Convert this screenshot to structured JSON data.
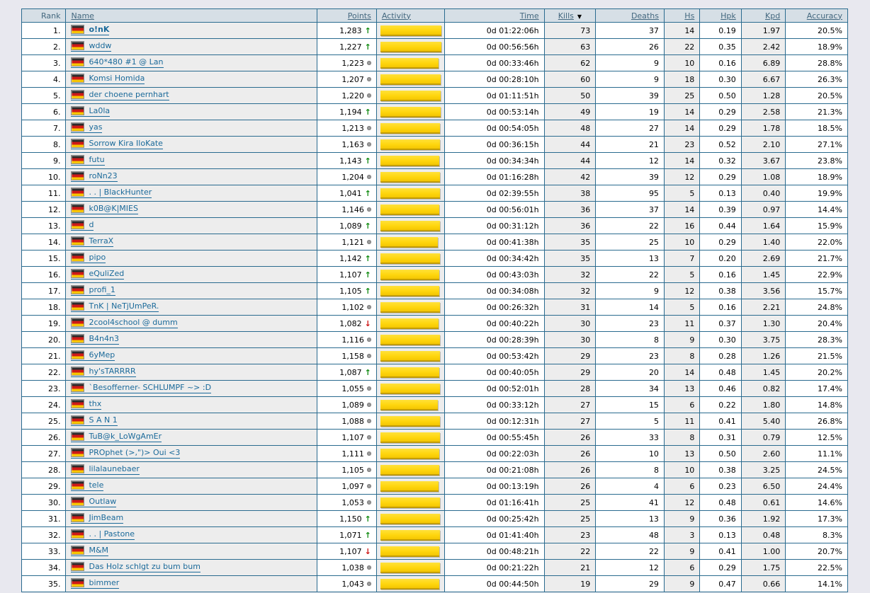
{
  "table": {
    "sorted_by": "Kills",
    "sort_direction": "desc",
    "columns": [
      {
        "label": "Rank"
      },
      {
        "label": "Name"
      },
      {
        "label": "Points"
      },
      {
        "label": "Activity"
      },
      {
        "label": "Time"
      },
      {
        "label": "Kills"
      },
      {
        "label": "Deaths"
      },
      {
        "label": "Hs"
      },
      {
        "label": "Hpk"
      },
      {
        "label": "Kpd"
      },
      {
        "label": "Accuracy"
      }
    ],
    "rows": [
      {
        "rank": "1.",
        "flag": "germany",
        "name": "o!nK",
        "bold": true,
        "points": "1,283",
        "trend": "up",
        "activity_pct": 100,
        "time": "0d 01:22:06h",
        "kills": "73",
        "deaths": "37",
        "hs": "14",
        "hpk": "0.19",
        "kpd": "1.97",
        "accuracy": "20.5%"
      },
      {
        "rank": "2.",
        "flag": "germany",
        "name": "wddw",
        "bold": false,
        "points": "1,227",
        "trend": "up",
        "activity_pct": 100,
        "time": "0d 00:56:56h",
        "kills": "63",
        "deaths": "26",
        "hs": "22",
        "hpk": "0.35",
        "kpd": "2.42",
        "accuracy": "18.9%"
      },
      {
        "rank": "3.",
        "flag": "germany",
        "name": "640*480 #1 @ Lan",
        "bold": false,
        "points": "1,223",
        "trend": "steady",
        "activity_pct": 95,
        "time": "0d 00:33:46h",
        "kills": "62",
        "deaths": "9",
        "hs": "10",
        "hpk": "0.16",
        "kpd": "6.89",
        "accuracy": "28.8%"
      },
      {
        "rank": "4.",
        "flag": "germany",
        "name": "Komsi Homida",
        "bold": false,
        "points": "1,207",
        "trend": "steady",
        "activity_pct": 99,
        "time": "0d 00:28:10h",
        "kills": "60",
        "deaths": "9",
        "hs": "18",
        "hpk": "0.30",
        "kpd": "6.67",
        "accuracy": "26.3%"
      },
      {
        "rank": "5.",
        "flag": "germany",
        "name": "der choene pernhart",
        "bold": false,
        "points": "1,220",
        "trend": "steady",
        "activity_pct": 99,
        "time": "0d 01:11:51h",
        "kills": "50",
        "deaths": "39",
        "hs": "25",
        "hpk": "0.50",
        "kpd": "1.28",
        "accuracy": "20.5%"
      },
      {
        "rank": "6.",
        "flag": "germany",
        "name": "La0la",
        "bold": false,
        "points": "1,194",
        "trend": "up",
        "activity_pct": 99,
        "time": "0d 00:53:14h",
        "kills": "49",
        "deaths": "19",
        "hs": "14",
        "hpk": "0.29",
        "kpd": "2.58",
        "accuracy": "21.3%"
      },
      {
        "rank": "7.",
        "flag": "germany",
        "name": "yas",
        "bold": false,
        "points": "1,213",
        "trend": "steady",
        "activity_pct": 98,
        "time": "0d 00:54:05h",
        "kills": "48",
        "deaths": "27",
        "hs": "14",
        "hpk": "0.29",
        "kpd": "1.78",
        "accuracy": "18.5%"
      },
      {
        "rank": "8.",
        "flag": "germany",
        "name": "Sorrow Kira IloKate",
        "bold": false,
        "points": "1,163",
        "trend": "steady",
        "activity_pct": 98,
        "time": "0d 00:36:15h",
        "kills": "44",
        "deaths": "21",
        "hs": "23",
        "hpk": "0.52",
        "kpd": "2.10",
        "accuracy": "27.1%"
      },
      {
        "rank": "9.",
        "flag": "germany",
        "name": "futu",
        "bold": false,
        "points": "1,143",
        "trend": "up",
        "activity_pct": 96,
        "time": "0d 00:34:34h",
        "kills": "44",
        "deaths": "12",
        "hs": "14",
        "hpk": "0.32",
        "kpd": "3.67",
        "accuracy": "23.8%"
      },
      {
        "rank": "10.",
        "flag": "germany",
        "name": "roNn23",
        "bold": false,
        "points": "1,204",
        "trend": "steady",
        "activity_pct": 98,
        "time": "0d 01:16:28h",
        "kills": "42",
        "deaths": "39",
        "hs": "12",
        "hpk": "0.29",
        "kpd": "1.08",
        "accuracy": "18.9%"
      },
      {
        "rank": "11.",
        "flag": "germany",
        "name": ". . | BlackHunter",
        "bold": false,
        "points": "1,041",
        "trend": "up",
        "activity_pct": 98,
        "time": "0d 02:39:55h",
        "kills": "38",
        "deaths": "95",
        "hs": "5",
        "hpk": "0.13",
        "kpd": "0.40",
        "accuracy": "19.9%"
      },
      {
        "rank": "12.",
        "flag": "germany",
        "name": "k0B@K|MIES",
        "bold": false,
        "points": "1,146",
        "trend": "steady",
        "activity_pct": 96,
        "time": "0d 00:56:01h",
        "kills": "36",
        "deaths": "37",
        "hs": "14",
        "hpk": "0.39",
        "kpd": "0.97",
        "accuracy": "14.4%"
      },
      {
        "rank": "13.",
        "flag": "germany",
        "name": "d",
        "bold": false,
        "points": "1,089",
        "trend": "up",
        "activity_pct": 98,
        "time": "0d 00:31:12h",
        "kills": "36",
        "deaths": "22",
        "hs": "16",
        "hpk": "0.44",
        "kpd": "1.64",
        "accuracy": "15.9%"
      },
      {
        "rank": "14.",
        "flag": "germany",
        "name": "TerraX",
        "bold": false,
        "points": "1,121",
        "trend": "steady",
        "activity_pct": 94,
        "time": "0d 00:41:38h",
        "kills": "35",
        "deaths": "25",
        "hs": "10",
        "hpk": "0.29",
        "kpd": "1.40",
        "accuracy": "22.0%"
      },
      {
        "rank": "15.",
        "flag": "germany",
        "name": "pipo",
        "bold": false,
        "points": "1,142",
        "trend": "up",
        "activity_pct": 98,
        "time": "0d 00:34:42h",
        "kills": "35",
        "deaths": "13",
        "hs": "7",
        "hpk": "0.20",
        "kpd": "2.69",
        "accuracy": "21.7%"
      },
      {
        "rank": "16.",
        "flag": "germany",
        "name": "eQuliZed",
        "bold": false,
        "points": "1,107",
        "trend": "up",
        "activity_pct": 96,
        "time": "0d 00:43:03h",
        "kills": "32",
        "deaths": "22",
        "hs": "5",
        "hpk": "0.16",
        "kpd": "1.45",
        "accuracy": "22.9%"
      },
      {
        "rank": "17.",
        "flag": "germany",
        "name": "profi_1",
        "bold": false,
        "points": "1,105",
        "trend": "up",
        "activity_pct": 96,
        "time": "0d 00:34:08h",
        "kills": "32",
        "deaths": "9",
        "hs": "12",
        "hpk": "0.38",
        "kpd": "3.56",
        "accuracy": "15.7%"
      },
      {
        "rank": "18.",
        "flag": "germany",
        "name": "TnK | NeTjUmPeR.",
        "bold": false,
        "points": "1,102",
        "trend": "steady",
        "activity_pct": 98,
        "time": "0d 00:26:32h",
        "kills": "31",
        "deaths": "14",
        "hs": "5",
        "hpk": "0.16",
        "kpd": "2.21",
        "accuracy": "24.8%"
      },
      {
        "rank": "19.",
        "flag": "germany",
        "name": "2cool4school @ dumm",
        "bold": false,
        "points": "1,082",
        "trend": "down",
        "activity_pct": 95,
        "time": "0d 00:40:22h",
        "kills": "30",
        "deaths": "23",
        "hs": "11",
        "hpk": "0.37",
        "kpd": "1.30",
        "accuracy": "20.4%"
      },
      {
        "rank": "20.",
        "flag": "germany",
        "name": "B4n4n3",
        "bold": false,
        "points": "1,116",
        "trend": "steady",
        "activity_pct": 98,
        "time": "0d 00:28:39h",
        "kills": "30",
        "deaths": "8",
        "hs": "9",
        "hpk": "0.30",
        "kpd": "3.75",
        "accuracy": "28.3%"
      },
      {
        "rank": "21.",
        "flag": "germany",
        "name": "6yMep",
        "bold": false,
        "points": "1,158",
        "trend": "steady",
        "activity_pct": 98,
        "time": "0d 00:53:42h",
        "kills": "29",
        "deaths": "23",
        "hs": "8",
        "hpk": "0.28",
        "kpd": "1.26",
        "accuracy": "21.5%"
      },
      {
        "rank": "22.",
        "flag": "germany",
        "name": "hy'sTARRRR",
        "bold": false,
        "points": "1,087",
        "trend": "up",
        "activity_pct": 97,
        "time": "0d 00:40:05h",
        "kills": "29",
        "deaths": "20",
        "hs": "14",
        "hpk": "0.48",
        "kpd": "1.45",
        "accuracy": "20.2%"
      },
      {
        "rank": "23.",
        "flag": "germany",
        "name": "`Besofferner- SCHLUMPF ~> :D",
        "bold": false,
        "points": "1,055",
        "trend": "steady",
        "activity_pct": 98,
        "time": "0d 00:52:01h",
        "kills": "28",
        "deaths": "34",
        "hs": "13",
        "hpk": "0.46",
        "kpd": "0.82",
        "accuracy": "17.4%"
      },
      {
        "rank": "24.",
        "flag": "germany",
        "name": "thx",
        "bold": false,
        "points": "1,089",
        "trend": "steady",
        "activity_pct": 94,
        "time": "0d 00:33:12h",
        "kills": "27",
        "deaths": "15",
        "hs": "6",
        "hpk": "0.22",
        "kpd": "1.80",
        "accuracy": "14.8%"
      },
      {
        "rank": "25.",
        "flag": "germany",
        "name": "S A N 1",
        "bold": false,
        "points": "1,088",
        "trend": "steady",
        "activity_pct": 98,
        "time": "0d 00:12:31h",
        "kills": "27",
        "deaths": "5",
        "hs": "11",
        "hpk": "0.41",
        "kpd": "5.40",
        "accuracy": "26.8%"
      },
      {
        "rank": "26.",
        "flag": "germany",
        "name": "TuB@k_LoWgAmEr",
        "bold": false,
        "points": "1,107",
        "trend": "steady",
        "activity_pct": 98,
        "time": "0d 00:55:45h",
        "kills": "26",
        "deaths": "33",
        "hs": "8",
        "hpk": "0.31",
        "kpd": "0.79",
        "accuracy": "12.5%"
      },
      {
        "rank": "27.",
        "flag": "germany",
        "name": "PROphet (>,\")> Oui <3",
        "bold": false,
        "points": "1,111",
        "trend": "steady",
        "activity_pct": 96,
        "time": "0d 00:22:03h",
        "kills": "26",
        "deaths": "10",
        "hs": "13",
        "hpk": "0.50",
        "kpd": "2.60",
        "accuracy": "11.1%"
      },
      {
        "rank": "28.",
        "flag": "germany",
        "name": "lilalaunebaer",
        "bold": false,
        "points": "1,105",
        "trend": "steady",
        "activity_pct": 97,
        "time": "0d 00:21:08h",
        "kills": "26",
        "deaths": "8",
        "hs": "10",
        "hpk": "0.38",
        "kpd": "3.25",
        "accuracy": "24.5%"
      },
      {
        "rank": "29.",
        "flag": "germany",
        "name": "tele",
        "bold": false,
        "points": "1,097",
        "trend": "steady",
        "activity_pct": 95,
        "time": "0d 00:13:19h",
        "kills": "26",
        "deaths": "4",
        "hs": "6",
        "hpk": "0.23",
        "kpd": "6.50",
        "accuracy": "24.4%"
      },
      {
        "rank": "30.",
        "flag": "germany",
        "name": "Outlaw",
        "bold": false,
        "points": "1,053",
        "trend": "steady",
        "activity_pct": 98,
        "time": "0d 01:16:41h",
        "kills": "25",
        "deaths": "41",
        "hs": "12",
        "hpk": "0.48",
        "kpd": "0.61",
        "accuracy": "14.6%"
      },
      {
        "rank": "31.",
        "flag": "germany",
        "name": "JimBeam",
        "bold": false,
        "points": "1,150",
        "trend": "up",
        "activity_pct": 98,
        "time": "0d 00:25:42h",
        "kills": "25",
        "deaths": "13",
        "hs": "9",
        "hpk": "0.36",
        "kpd": "1.92",
        "accuracy": "17.3%"
      },
      {
        "rank": "32.",
        "flag": "germany",
        "name": ". . | Pastone",
        "bold": false,
        "points": "1,071",
        "trend": "up",
        "activity_pct": 98,
        "time": "0d 01:41:40h",
        "kills": "23",
        "deaths": "48",
        "hs": "3",
        "hpk": "0.13",
        "kpd": "0.48",
        "accuracy": "8.3%"
      },
      {
        "rank": "33.",
        "flag": "germany",
        "name": "M&M",
        "bold": false,
        "points": "1,107",
        "trend": "down",
        "activity_pct": 96,
        "time": "0d 00:48:21h",
        "kills": "22",
        "deaths": "22",
        "hs": "9",
        "hpk": "0.41",
        "kpd": "1.00",
        "accuracy": "20.7%"
      },
      {
        "rank": "34.",
        "flag": "germany",
        "name": "Das Holz schlgt zu bum bum",
        "bold": false,
        "points": "1,038",
        "trend": "steady",
        "activity_pct": 98,
        "time": "0d 00:21:22h",
        "kills": "21",
        "deaths": "12",
        "hs": "6",
        "hpk": "0.29",
        "kpd": "1.75",
        "accuracy": "22.5%"
      },
      {
        "rank": "35.",
        "flag": "germany",
        "name": "bimmer",
        "bold": false,
        "points": "1,043",
        "trend": "steady",
        "activity_pct": 97,
        "time": "0d 00:44:50h",
        "kills": "19",
        "deaths": "29",
        "hs": "9",
        "hpk": "0.47",
        "kpd": "0.66",
        "accuracy": "14.1%"
      }
    ]
  },
  "icons": {
    "sort_desc": "▼",
    "trend_up": "↑",
    "trend_down": "↓"
  },
  "colors": {
    "border": "#2a6b8f",
    "header_bg": "#d6dfe6",
    "header_text": "#44687f",
    "shaded_column_bg": "#ededed",
    "player_link": "#1b6a9a",
    "activity_bar": "#ffd60e",
    "trend_up": "#0f8a0f",
    "trend_down": "#cc1111",
    "trend_steady": "#9a9a9a",
    "page_bg": "#e8e8ef"
  }
}
